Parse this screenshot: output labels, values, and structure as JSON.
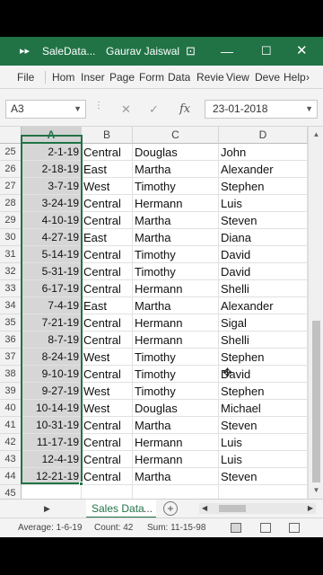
{
  "titlebar": {
    "title": "SaleData...",
    "user": "Gaurav Jaiswal",
    "qat_icon": "more-arrows-icon",
    "ribbon_icon": "ribbon-display-icon",
    "minimize": "—",
    "maximize": "☐",
    "close": "✕"
  },
  "ribbon": {
    "tabs": [
      "File",
      "Hom",
      "Inser",
      "Page",
      "Form",
      "Data",
      "Revie",
      "View",
      "Deve",
      "Help"
    ],
    "overflow": "›"
  },
  "formula_bar": {
    "name_box": "A3",
    "cancel": "✕",
    "enter": "✓",
    "fx": "fx",
    "value": "23-01-2018"
  },
  "grid": {
    "columns": [
      "A",
      "B",
      "C",
      "D"
    ],
    "rows": [
      {
        "n": "25",
        "a": "2-1-19",
        "b": "Central",
        "c": "Douglas",
        "d": "John"
      },
      {
        "n": "26",
        "a": "2-18-19",
        "b": "East",
        "c": "Martha",
        "d": "Alexander"
      },
      {
        "n": "27",
        "a": "3-7-19",
        "b": "West",
        "c": "Timothy",
        "d": "Stephen"
      },
      {
        "n": "28",
        "a": "3-24-19",
        "b": "Central",
        "c": "Hermann",
        "d": "Luis"
      },
      {
        "n": "29",
        "a": "4-10-19",
        "b": "Central",
        "c": "Martha",
        "d": "Steven"
      },
      {
        "n": "30",
        "a": "4-27-19",
        "b": "East",
        "c": "Martha",
        "d": "Diana"
      },
      {
        "n": "31",
        "a": "5-14-19",
        "b": "Central",
        "c": "Timothy",
        "d": "David"
      },
      {
        "n": "32",
        "a": "5-31-19",
        "b": "Central",
        "c": "Timothy",
        "d": "David"
      },
      {
        "n": "33",
        "a": "6-17-19",
        "b": "Central",
        "c": "Hermann",
        "d": "Shelli"
      },
      {
        "n": "34",
        "a": "7-4-19",
        "b": "East",
        "c": "Martha",
        "d": "Alexander"
      },
      {
        "n": "35",
        "a": "7-21-19",
        "b": "Central",
        "c": "Hermann",
        "d": "Sigal"
      },
      {
        "n": "36",
        "a": "8-7-19",
        "b": "Central",
        "c": "Hermann",
        "d": "Shelli"
      },
      {
        "n": "37",
        "a": "8-24-19",
        "b": "West",
        "c": "Timothy",
        "d": "Stephen"
      },
      {
        "n": "38",
        "a": "9-10-19",
        "b": "Central",
        "c": "Timothy",
        "d": "David"
      },
      {
        "n": "39",
        "a": "9-27-19",
        "b": "West",
        "c": "Timothy",
        "d": "Stephen"
      },
      {
        "n": "40",
        "a": "10-14-19",
        "b": "West",
        "c": "Douglas",
        "d": "Michael"
      },
      {
        "n": "41",
        "a": "10-31-19",
        "b": "Central",
        "c": "Martha",
        "d": "Steven"
      },
      {
        "n": "42",
        "a": "11-17-19",
        "b": "Central",
        "c": "Hermann",
        "d": "Luis"
      },
      {
        "n": "43",
        "a": "12-4-19",
        "b": "Central",
        "c": "Hermann",
        "d": "Luis"
      },
      {
        "n": "44",
        "a": "12-21-19",
        "b": "Central",
        "c": "Martha",
        "d": "Steven"
      },
      {
        "n": "45",
        "a": "",
        "b": "",
        "c": "",
        "d": ""
      }
    ]
  },
  "sheets": {
    "active": "Sales Data",
    "more": "...",
    "add": "+"
  },
  "status": {
    "average": "Average: 1-6-19",
    "count": "Count: 42",
    "sum": "Sum: 11-15-98"
  },
  "colors": {
    "accent": "#217346",
    "selection": "#d6d6d6"
  }
}
